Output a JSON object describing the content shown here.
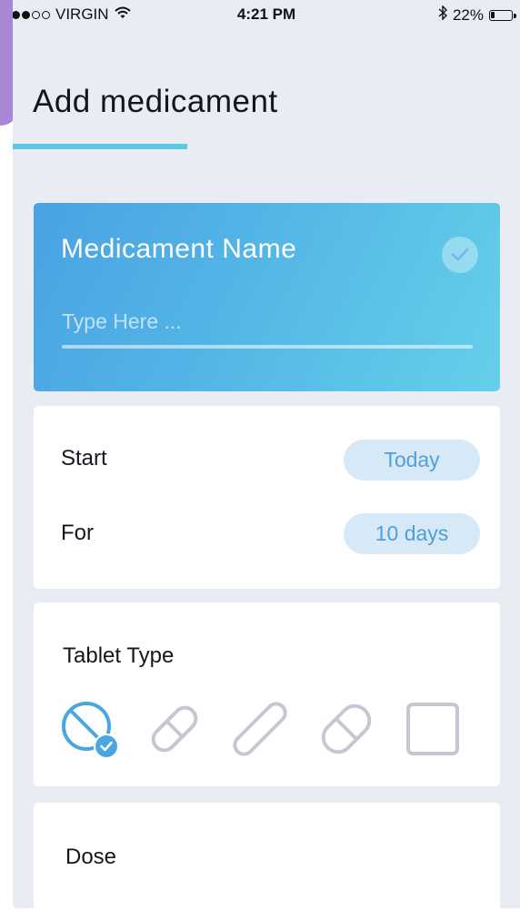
{
  "status_bar": {
    "carrier": "VIRGIN",
    "time": "4:21 PM",
    "battery": "22%",
    "battery_level": 0.22
  },
  "page": {
    "title": "Add medicament"
  },
  "name_card": {
    "label": "Medicament Name",
    "placeholder": "Type Here ...",
    "value": ""
  },
  "schedule": {
    "start_label": "Start",
    "start_value": "Today",
    "for_label": "For",
    "for_value": "10 days"
  },
  "tablet_type": {
    "label": "Tablet Type",
    "options": [
      {
        "icon": "round-tablet-icon",
        "selected": true
      },
      {
        "icon": "capsule-icon",
        "selected": false
      },
      {
        "icon": "long-capsule-icon",
        "selected": false
      },
      {
        "icon": "oval-pill-icon",
        "selected": false
      },
      {
        "icon": "square-tablet-icon",
        "selected": false
      }
    ]
  },
  "dose": {
    "label": "Dose"
  },
  "colors": {
    "accent": "#5bc8e4",
    "card_gradient_start": "#4aa2e2",
    "card_gradient_end": "#64d0ea",
    "pill_bg": "#d7e9f7",
    "pill_text": "#4f9fd9",
    "selected_icon": "#4aa6e0",
    "unselected_icon": "#c5c8d2"
  }
}
